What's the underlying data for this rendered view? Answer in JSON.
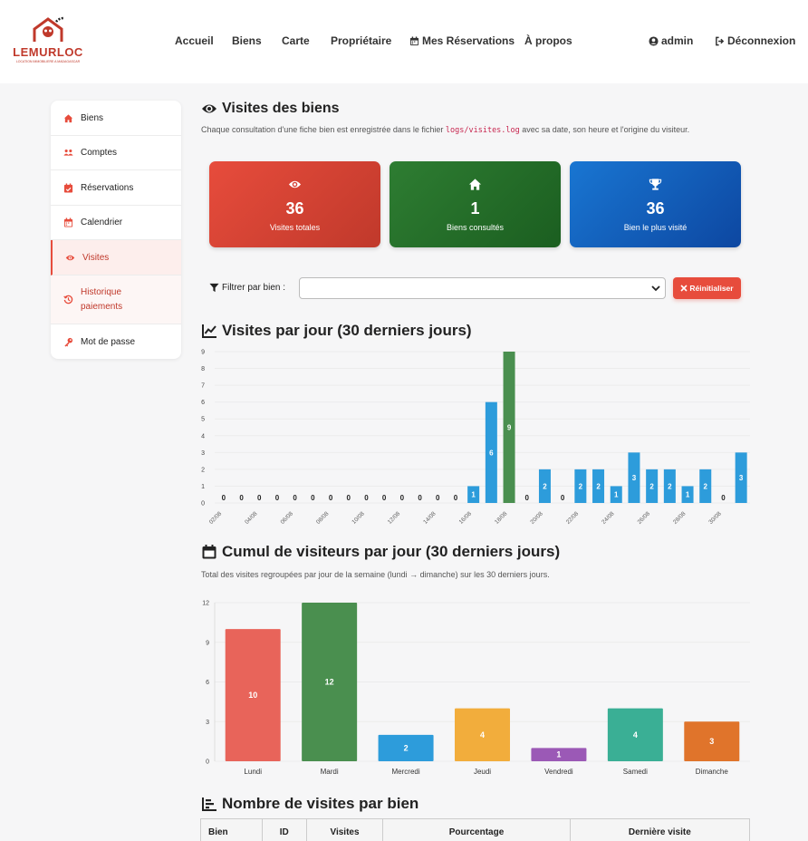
{
  "brand": {
    "name": "LEMURLOC",
    "tagline": "LOCATION IMMOBILIERE A MADAGASCAR",
    "accent": "#e74c3c"
  },
  "nav": {
    "items": [
      "Accueil",
      "Biens",
      "Carte",
      "Propriétaire",
      "Mes Réservations",
      "À propos"
    ],
    "user": "admin",
    "logout": "Déconnexion"
  },
  "sidebar": {
    "items": [
      {
        "label": "Biens",
        "icon": "home-icon"
      },
      {
        "label": "Comptes",
        "icon": "users-icon"
      },
      {
        "label": "Réservations",
        "icon": "calendar-check-icon"
      },
      {
        "label": "Calendrier",
        "icon": "calendar-icon"
      },
      {
        "label": "Visites",
        "icon": "eye-icon"
      },
      {
        "label": "Historique paiements",
        "icon": "history-icon"
      },
      {
        "label": "Mot de passe",
        "icon": "key-icon"
      }
    ],
    "active": "Visites"
  },
  "page": {
    "title": "Visites des biens",
    "desc_before": "Chaque consultation d'une fiche bien est enregistrée dans le fichier ",
    "desc_code": "logs/visites.log",
    "desc_after": " avec sa date, son heure et l'origine du visiteur."
  },
  "cards": [
    {
      "value": "36",
      "label": "Visites totales",
      "icon": "eye-icon",
      "color": "#e74c3c"
    },
    {
      "value": "1",
      "label": "Biens consultés",
      "icon": "home-icon",
      "color": "#2e7d32"
    },
    {
      "value": "36",
      "label": "Bien le plus visité",
      "icon": "trophy-icon",
      "color": "#1565c0"
    }
  ],
  "filter": {
    "label": "Filtrer par bien :",
    "value": "",
    "reset": "Réinitialiser"
  },
  "chart1_title": "Visites par jour (30 derniers jours)",
  "chart2_title": "Cumul de visiteurs par jour (30 derniers jours)",
  "chart2_desc": "Total des visites regroupées par jour de la semaine (lundi → dimanche) sur les 30 derniers jours.",
  "table_title": "Nombre de visites par bien",
  "table": {
    "headers": [
      "Bien",
      "ID",
      "Visites",
      "Pourcentage",
      "Dernière visite"
    ]
  },
  "chart_data": [
    {
      "type": "bar",
      "categories": [
        "02/08",
        "03/08",
        "04/08",
        "05/08",
        "06/08",
        "07/08",
        "08/08",
        "09/08",
        "10/08",
        "11/08",
        "12/08",
        "13/08",
        "14/08",
        "15/08",
        "16/08",
        "17/08",
        "18/08",
        "19/08",
        "20/08",
        "21/08",
        "22/08",
        "23/08",
        "24/08",
        "25/08",
        "26/08",
        "27/08",
        "28/08",
        "29/08",
        "30/08",
        "31/08"
      ],
      "tick_labels": [
        "02/08",
        "04/08",
        "06/08",
        "08/08",
        "10/08",
        "12/08",
        "14/08",
        "16/08",
        "18/08",
        "20/08",
        "22/08",
        "24/08",
        "26/08",
        "28/08",
        "30/08"
      ],
      "values": [
        0,
        0,
        0,
        0,
        0,
        0,
        0,
        0,
        0,
        0,
        0,
        0,
        0,
        0,
        1,
        6,
        9,
        0,
        2,
        0,
        2,
        2,
        1,
        3,
        2,
        2,
        1,
        2,
        0,
        3
      ],
      "highlight_index": 16,
      "colors": {
        "default": "#2d9cdb",
        "highlight": "#4a8f4f"
      },
      "ylim": [
        0,
        9
      ],
      "yticks": [
        0,
        1,
        2,
        3,
        4,
        5,
        6,
        7,
        8,
        9
      ],
      "grid": true
    },
    {
      "type": "bar",
      "categories": [
        "Lundi",
        "Mardi",
        "Mercredi",
        "Jeudi",
        "Vendredi",
        "Samedi",
        "Dimanche"
      ],
      "values": [
        10,
        12,
        2,
        4,
        1,
        4,
        3
      ],
      "colors": [
        "#e8645a",
        "#4a8f4f",
        "#2d9cdb",
        "#f2ad3c",
        "#9b59b6",
        "#3aaf95",
        "#e0742b"
      ],
      "ylim": [
        0,
        12
      ],
      "yticks": [
        0,
        3,
        6,
        9,
        12
      ],
      "grid": true
    }
  ]
}
